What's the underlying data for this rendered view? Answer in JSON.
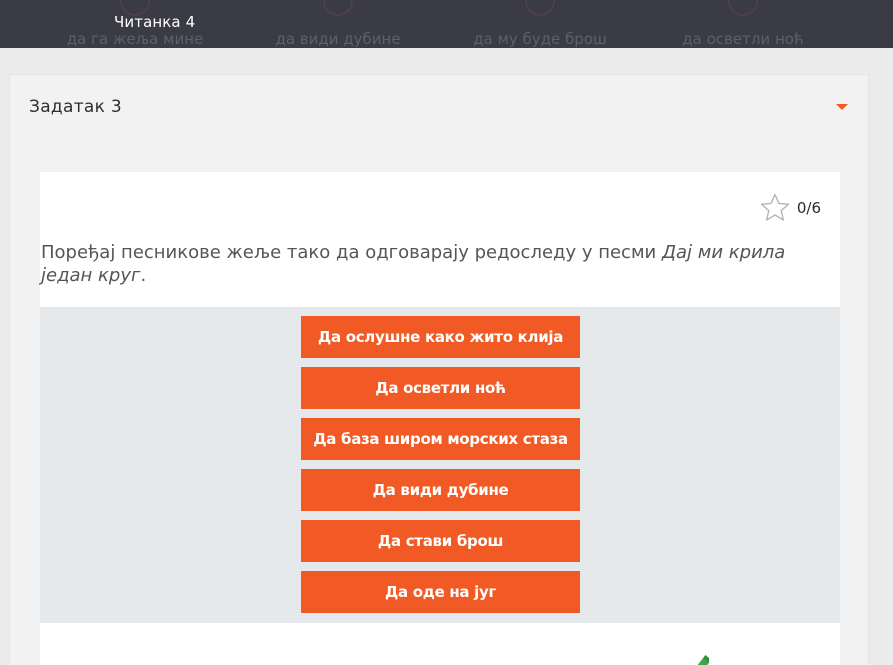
{
  "header": {
    "title": "Читанка 4",
    "steps": [
      "да га жеља мине",
      "да види дубине",
      "да му буде брош",
      "да осветли ноћ"
    ]
  },
  "panel": {
    "title": "Задатак 3",
    "caret_icon": "caret-down-icon",
    "accent_color": "#f15a24"
  },
  "task": {
    "score": "0/6",
    "score_icon": "star-outline-icon",
    "instruction_prefix": "Поређај песникове жеље тако да одговарају редоследу у песми ",
    "instruction_title": "Дај ми крила један круг",
    "instruction_suffix": ".",
    "items": [
      "Да ослушне како жито клија",
      "Да осветли ноћ",
      "Да база широм морских стаза",
      "Да види дубине",
      "Да стави брош",
      "Да оде на југ"
    ],
    "item_color": "#f15a24",
    "dropzone_color": "#e5e9eb",
    "check_icon": "pencil-check-icon",
    "check_color": "#3ca64a"
  }
}
